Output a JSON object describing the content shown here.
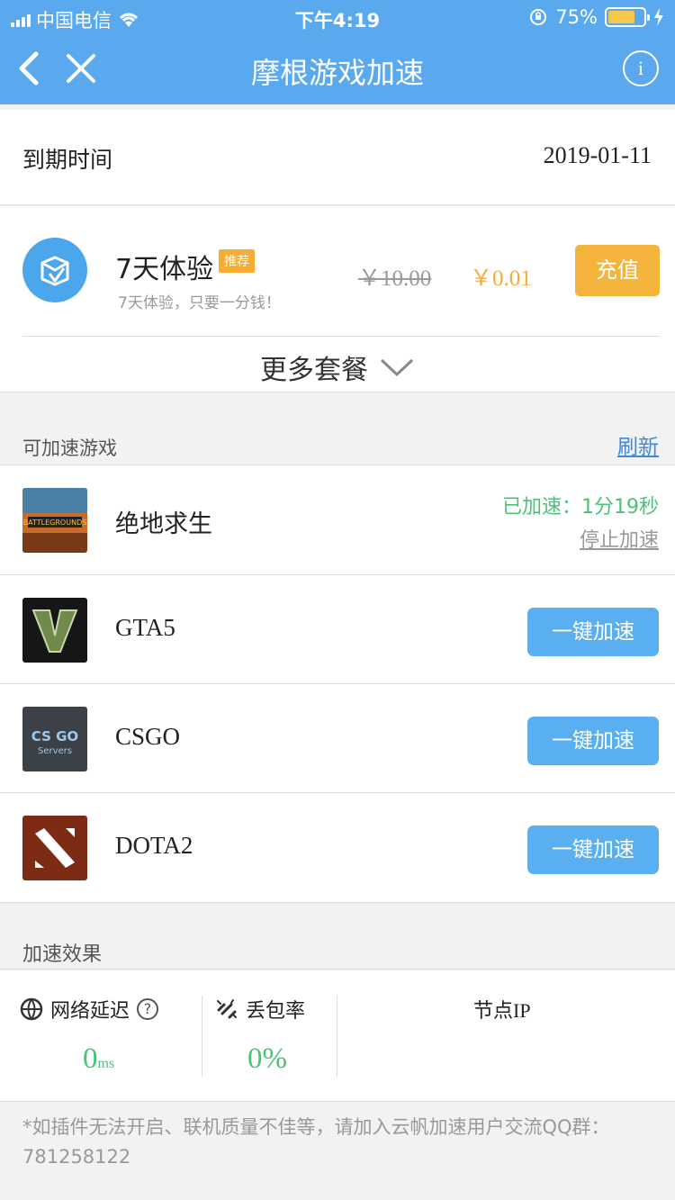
{
  "status_bar": {
    "carrier": "中国电信",
    "time": "下午4:19",
    "battery": "75%",
    "battery_level": 0.75
  },
  "nav": {
    "title": "摩根游戏加速",
    "info_label": "i"
  },
  "expire": {
    "label": "到期时间",
    "value": "2019-01-11"
  },
  "plan": {
    "name": "7天体验",
    "tag": "推荐",
    "desc": "7天体验，只要一分钱！",
    "old_price": "￥10.00",
    "new_price": "￥0.01",
    "charge_label": "充值",
    "more_label": "更多套餐"
  },
  "games_section": {
    "title": "可加速游戏",
    "refresh_label": "刷新",
    "items": [
      {
        "name": "绝地求生",
        "status": "已加速：1分19秒",
        "stop_label": "停止加速"
      },
      {
        "name": "GTA5",
        "button": "一键加速"
      },
      {
        "name": "CSGO",
        "button": "一键加速"
      },
      {
        "name": "DOTA2",
        "button": "一键加速"
      }
    ]
  },
  "effect": {
    "title": "加速效果",
    "latency_label": "网络延迟",
    "latency_value": "0",
    "latency_unit": "ms",
    "loss_label": "丢包率",
    "loss_value": "0%",
    "node_label": "节点IP",
    "help_icon": "?"
  },
  "note": "*如插件无法开启、联机质量不佳等，请加入云帆加速用户交流QQ群：781258122",
  "colors": {
    "primary": "#5aa9ef",
    "orange": "#f5ad36",
    "green": "#4cc278"
  }
}
